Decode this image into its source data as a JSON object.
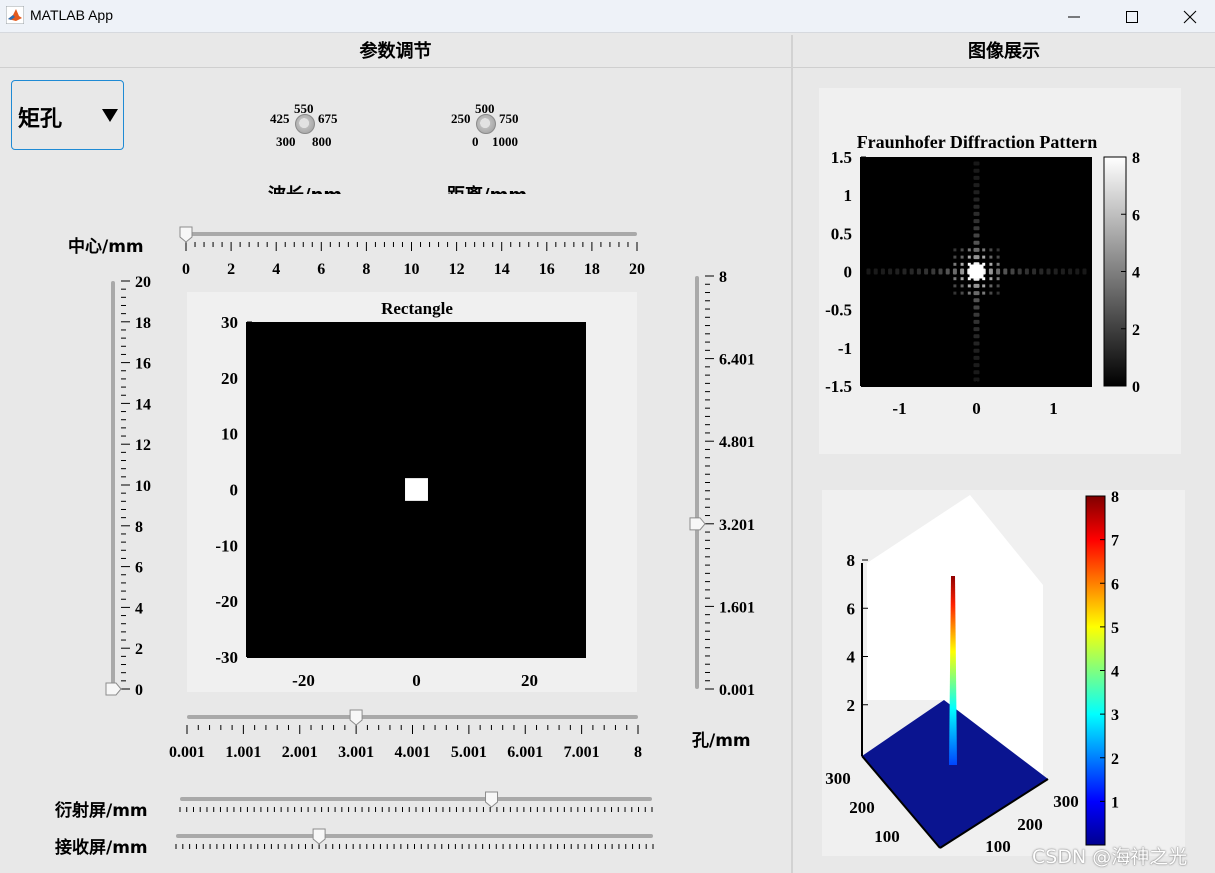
{
  "window": {
    "title": "MATLAB App",
    "minimize": "minimize",
    "maximize": "maximize",
    "close": "close"
  },
  "panels": {
    "left_title": "参数调节",
    "right_title": "图像展示"
  },
  "aperture_dropdown": {
    "selected": "矩孔"
  },
  "wavelength_knob": {
    "label": "波长/nm",
    "ticks": [
      "300",
      "425",
      "550",
      "675",
      "800"
    ]
  },
  "distance_knob": {
    "label": "距离/mm",
    "ticks": [
      "0",
      "250",
      "500",
      "750",
      "1000"
    ]
  },
  "center_slider": {
    "label": "中心/mm",
    "ticks": [
      "0",
      "2",
      "4",
      "6",
      "8",
      "10",
      "12",
      "14",
      "16",
      "18",
      "20"
    ],
    "value": 0
  },
  "vertical_slider_left": {
    "ticks": [
      "0",
      "2",
      "4",
      "6",
      "8",
      "10",
      "12",
      "14",
      "16",
      "18",
      "20"
    ],
    "value": 0
  },
  "hole_slider": {
    "label": "孔/mm",
    "ticks": [
      "0.001",
      "1.601",
      "3.201",
      "4.801",
      "6.401",
      "8"
    ],
    "value": 3.2
  },
  "bottom_slider": {
    "ticks": [
      "0.001",
      "1.001",
      "2.001",
      "3.001",
      "4.001",
      "5.001",
      "6.001",
      "7.001",
      "8"
    ],
    "value": 3.0
  },
  "diffraction_screen_slider": {
    "label": "衍射屏/mm",
    "value_fraction": 0.66
  },
  "receiving_screen_slider": {
    "label": "接收屏/mm",
    "value_fraction": 0.3
  },
  "watermark": "CSDN @海神之光",
  "chart_data": [
    {
      "type": "heatmap",
      "title": "Rectangle",
      "xticks": [
        "-20",
        "0",
        "20"
      ],
      "yticks": [
        "30",
        "20",
        "10",
        "0",
        "-10",
        "-20",
        "-30"
      ],
      "xlim": [
        -30,
        30
      ],
      "ylim": [
        -30,
        30
      ],
      "aperture": {
        "shape": "rectangle",
        "center": [
          0,
          0
        ],
        "width": 3,
        "height": 3
      },
      "colors": {
        "background": "#000000",
        "aperture": "#ffffff"
      }
    },
    {
      "type": "heatmap",
      "title": "Fraunhofer Diffraction Pattern",
      "xticks": [
        "-1",
        "0",
        "1"
      ],
      "yticks": [
        "1.5",
        "1",
        "0.5",
        "0",
        "-0.5",
        "-1",
        "-1.5"
      ],
      "xlim": [
        -1.5,
        1.5
      ],
      "ylim": [
        -1.5,
        1.5
      ],
      "colorbar": {
        "ticks": [
          "8",
          "6",
          "4",
          "2",
          "0"
        ],
        "range": [
          0,
          8
        ],
        "colormap": "gray"
      }
    },
    {
      "type": "surface",
      "zticks": [
        "8",
        "6",
        "4",
        "2"
      ],
      "xticks": [
        "100",
        "200",
        "300"
      ],
      "yticks": [
        "300",
        "200",
        "100"
      ],
      "zlim": [
        0,
        8
      ],
      "peak_value": 8,
      "colorbar": {
        "ticks": [
          "8",
          "7",
          "6",
          "5",
          "4",
          "3",
          "2",
          "1"
        ],
        "range": [
          0,
          8
        ],
        "colormap": "jet"
      }
    }
  ]
}
